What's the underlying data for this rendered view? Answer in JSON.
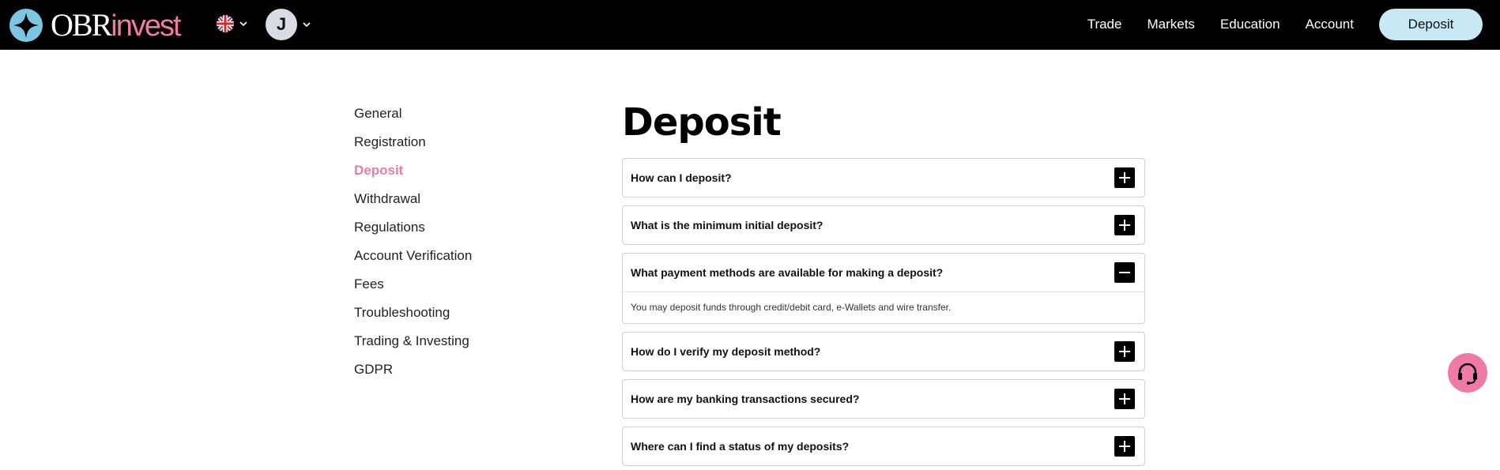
{
  "brand": {
    "part1": "OBR",
    "part2": "invest"
  },
  "header": {
    "avatar_initial": "J",
    "nav": [
      "Trade",
      "Markets",
      "Education",
      "Account"
    ],
    "deposit_label": "Deposit"
  },
  "sidebar": {
    "items": [
      {
        "label": "General"
      },
      {
        "label": "Registration"
      },
      {
        "label": "Deposit",
        "active": true
      },
      {
        "label": "Withdrawal"
      },
      {
        "label": "Regulations"
      },
      {
        "label": "Account Verification"
      },
      {
        "label": "Fees"
      },
      {
        "label": "Troubleshooting"
      },
      {
        "label": "Trading & Investing"
      },
      {
        "label": "GDPR"
      }
    ]
  },
  "main": {
    "title": "Deposit",
    "faqs": [
      {
        "question": "How can I deposit?",
        "expanded": false
      },
      {
        "question": "What is the minimum initial deposit?",
        "expanded": false
      },
      {
        "question": "What payment methods are available for making a deposit?",
        "expanded": true,
        "answer": "You may deposit funds through credit/debit card, e-Wallets and wire transfer."
      },
      {
        "question": "How do I verify my deposit method?",
        "expanded": false
      },
      {
        "question": "How are my banking transactions secured?",
        "expanded": false
      },
      {
        "question": "Where can I find a status of my deposits?",
        "expanded": false
      }
    ]
  },
  "colors": {
    "accent": "#f07aa6",
    "header_bg": "#000000",
    "deposit_btn": "#c8e8f5",
    "logo": "#7cc6e3"
  },
  "icons": {
    "language": "uk-flag-icon",
    "support": "headset-icon",
    "collapsed": "plus-icon",
    "expanded": "minus-icon"
  }
}
